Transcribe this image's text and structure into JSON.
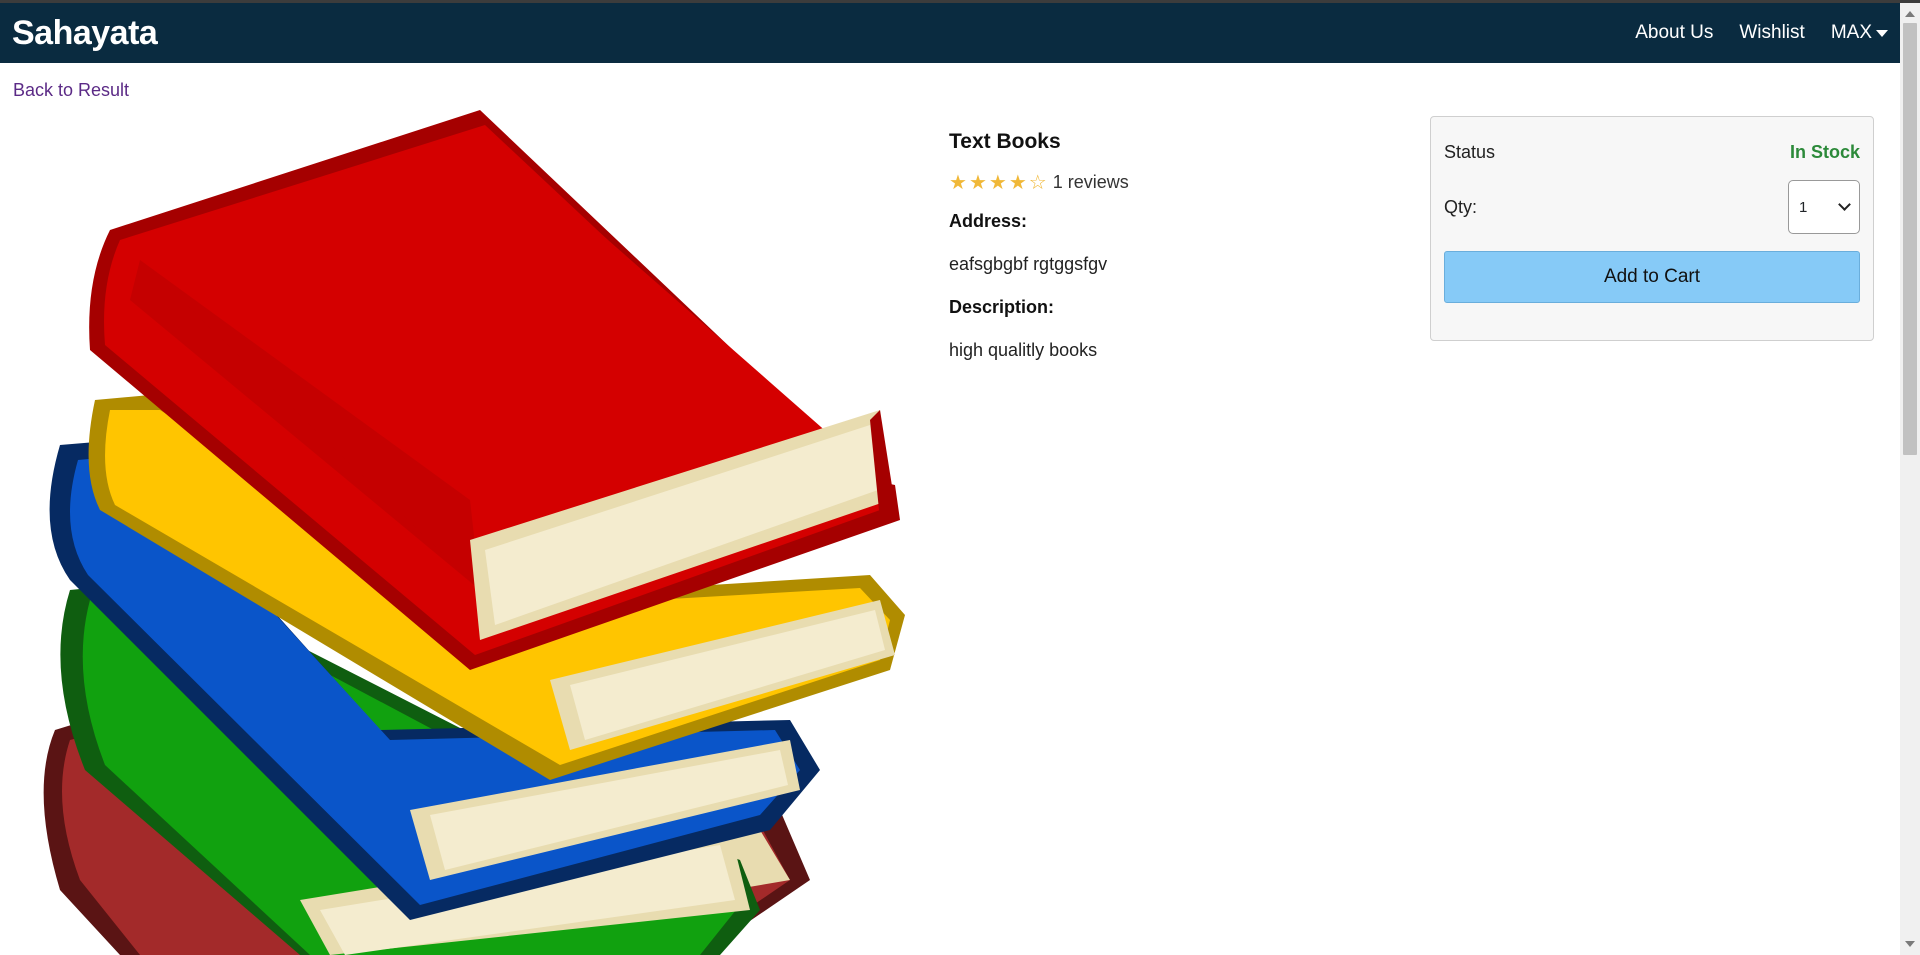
{
  "header": {
    "brand": "Sahayata",
    "links": [
      "About Us",
      "Wishlist"
    ],
    "user": "MAX"
  },
  "back_link": "Back to Result",
  "product": {
    "title": "Text Books",
    "rating": 4,
    "rating_max": 5,
    "reviews_text": "1 reviews",
    "address_label": "Address:",
    "address": "eafsgbgbf rgtggsfgv",
    "description_label": "Description:",
    "description": "high qualitly books",
    "image": "stack-of-books-illustration"
  },
  "cart": {
    "status_label": "Status",
    "status_value": "In Stock",
    "qty_label": "Qty:",
    "qty_value": "1",
    "add_button": "Add to Cart"
  },
  "colors": {
    "navbar": "#0a2b40",
    "in_stock": "#2c8a3a",
    "add_button": "#86caf7",
    "star": "#f0b838",
    "back_link": "#5b2a86"
  },
  "icons": {
    "user_menu": "caret-down-icon",
    "star": "star-icon",
    "select": "chevron-down-icon"
  }
}
